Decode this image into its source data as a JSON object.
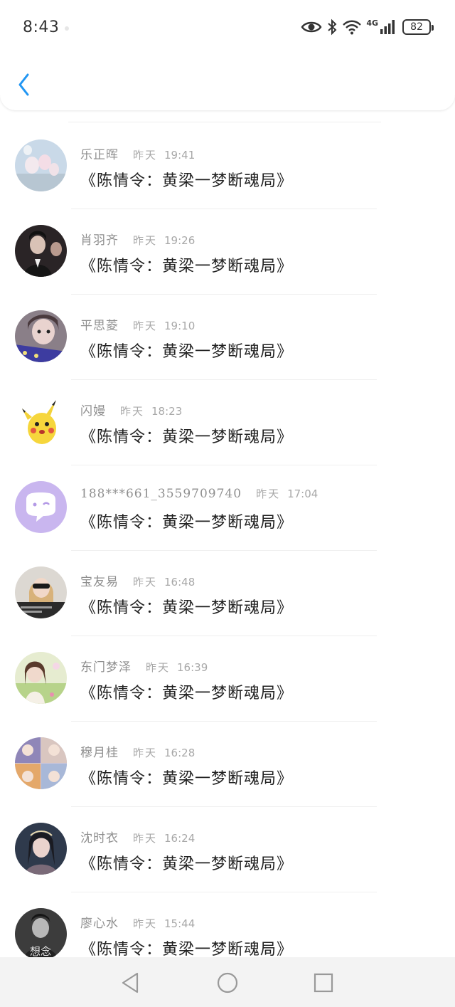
{
  "status_bar": {
    "time": "8:43",
    "network": "4G",
    "battery": "82",
    "icons": [
      "eye-icon",
      "bluetooth-icon",
      "wifi-icon",
      "signal-icon",
      "battery-icon"
    ]
  },
  "header": {
    "back_icon": "chevron-left-icon",
    "accent_color": "#2196f3"
  },
  "comments": [
    {
      "name": "乐正晖",
      "day": "昨天",
      "time": "19:41",
      "message": "《陈情令：黄梁一梦断魂局》",
      "avatar": "balloons"
    },
    {
      "name": "肖羽齐",
      "day": "昨天",
      "time": "19:26",
      "message": "《陈情令：黄梁一梦断魂局》",
      "avatar": "person-dark-suit"
    },
    {
      "name": "平思菱",
      "day": "昨天",
      "time": "19:10",
      "message": "《陈情令：黄梁一梦断魂局》",
      "avatar": "girl-photo"
    },
    {
      "name": "闪嫚",
      "day": "昨天",
      "time": "18:23",
      "message": "《陈情令：黄梁一梦断魂局》",
      "avatar": "pikachu"
    },
    {
      "name": "188***661_3559709740",
      "day": "昨天",
      "time": "17:04",
      "message": "《陈情令：黄梁一梦断魂局》",
      "avatar": "purple-chat-bubble"
    },
    {
      "name": "宝友易",
      "day": "昨天",
      "time": "16:48",
      "message": "《陈情令：黄梁一梦断魂局》",
      "avatar": "child-sunglasses"
    },
    {
      "name": "东门梦泽",
      "day": "昨天",
      "time": "16:39",
      "message": "《陈情令：黄梁一梦断魂局》",
      "avatar": "girl-meadow"
    },
    {
      "name": "穆月桂",
      "day": "昨天",
      "time": "16:28",
      "message": "《陈情令：黄梁一梦断魂局》",
      "avatar": "anime-collage"
    },
    {
      "name": "沈时衣",
      "day": "昨天",
      "time": "16:24",
      "message": "《陈情令：黄梁一梦断魂局》",
      "avatar": "woman-headpiece"
    },
    {
      "name": "廖心水",
      "day": "昨天",
      "time": "15:44",
      "message": "《陈情令：黄梁一梦断魂局》",
      "avatar": "man-monochrome",
      "avatar_text": "想念"
    }
  ],
  "nav_bar": {
    "buttons": [
      "back-triangle-icon",
      "home-circle-icon",
      "recents-square-icon"
    ]
  }
}
